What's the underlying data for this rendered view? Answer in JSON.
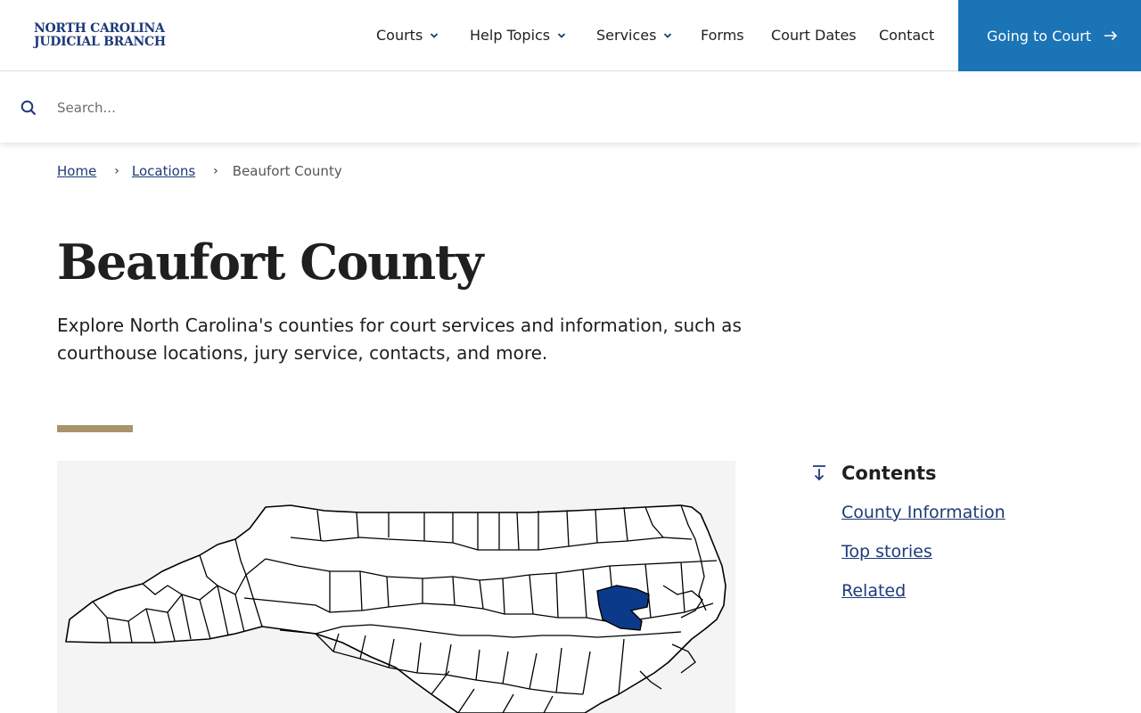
{
  "header": {
    "logo_line1": "NORTH CAROLINA",
    "logo_line2": "JUDICIAL BRANCH",
    "nav": [
      {
        "label": "Courts",
        "dropdown": true
      },
      {
        "label": "Help Topics",
        "dropdown": true
      },
      {
        "label": "Services",
        "dropdown": true
      },
      {
        "label": "Forms",
        "dropdown": false
      },
      {
        "label": "Court Dates",
        "dropdown": false
      },
      {
        "label": "Contact",
        "dropdown": false
      }
    ],
    "cta_label": "Going to Court"
  },
  "search": {
    "placeholder": "Search...",
    "value": ""
  },
  "breadcrumb": {
    "items": [
      "Home",
      "Locations"
    ],
    "current": "Beaufort County"
  },
  "page": {
    "title": "Beaufort County",
    "intro": "Explore North Carolina's counties for court services and information, such as courthouse locations, jury service, contacts, and more."
  },
  "map": {
    "highlighted_county": "Beaufort County",
    "highlight_color": "#0b3a8a",
    "background_color": "#f4f4f4"
  },
  "contents": {
    "title": "Contents",
    "links": [
      "County Information",
      "Top stories",
      "Related"
    ]
  },
  "colors": {
    "brand_navy": "#1e3a78",
    "cta_blue": "#1b74b5",
    "accent_gold": "#a8946a"
  }
}
